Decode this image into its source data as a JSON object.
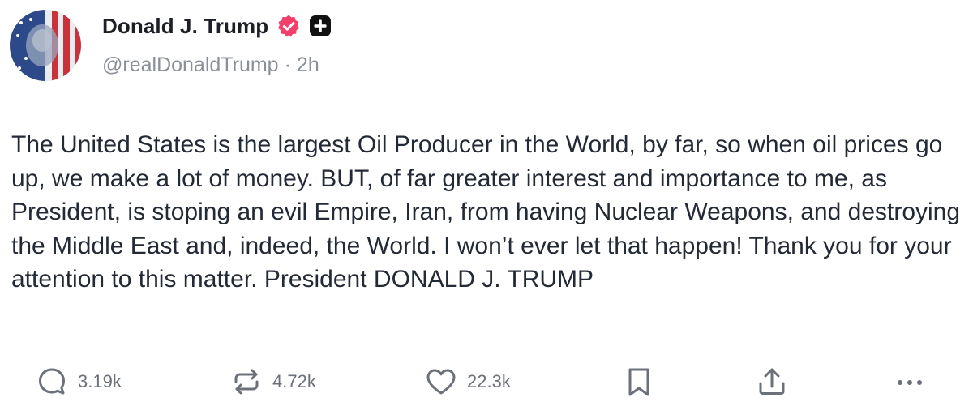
{
  "author": {
    "display_name": "Donald J. Trump",
    "handle": "@realDonaldTrump",
    "separator": "·",
    "time": "2h",
    "avatar_icon": "flag-portrait-avatar",
    "verified_icon": "verified-badge-icon",
    "verified_color": "#f43f6a",
    "badge_icon": "plus-badge-icon"
  },
  "post": {
    "text": "The United States is the largest Oil Producer in the World, by far, so when oil prices go up, we make a lot of money. BUT, of far greater interest and importance to me, as President, is stoping an evil Empire, Iran, from having Nuclear Weapons, and destroying the Middle East and, indeed, the World. I won’t ever let that happen! Thank you for your attention to this matter. President DONALD J. TRUMP"
  },
  "actions": {
    "replies": "3.19k",
    "reposts": "4.72k",
    "likes": "22.3k",
    "reply_icon": "reply-icon",
    "repost_icon": "repost-icon",
    "like_icon": "heart-icon",
    "bookmark_icon": "bookmark-icon",
    "share_icon": "share-icon",
    "more_icon": "more-icon"
  },
  "colors": {
    "text": "#242a35",
    "muted": "#8a8f98",
    "icon": "#6b7079"
  }
}
